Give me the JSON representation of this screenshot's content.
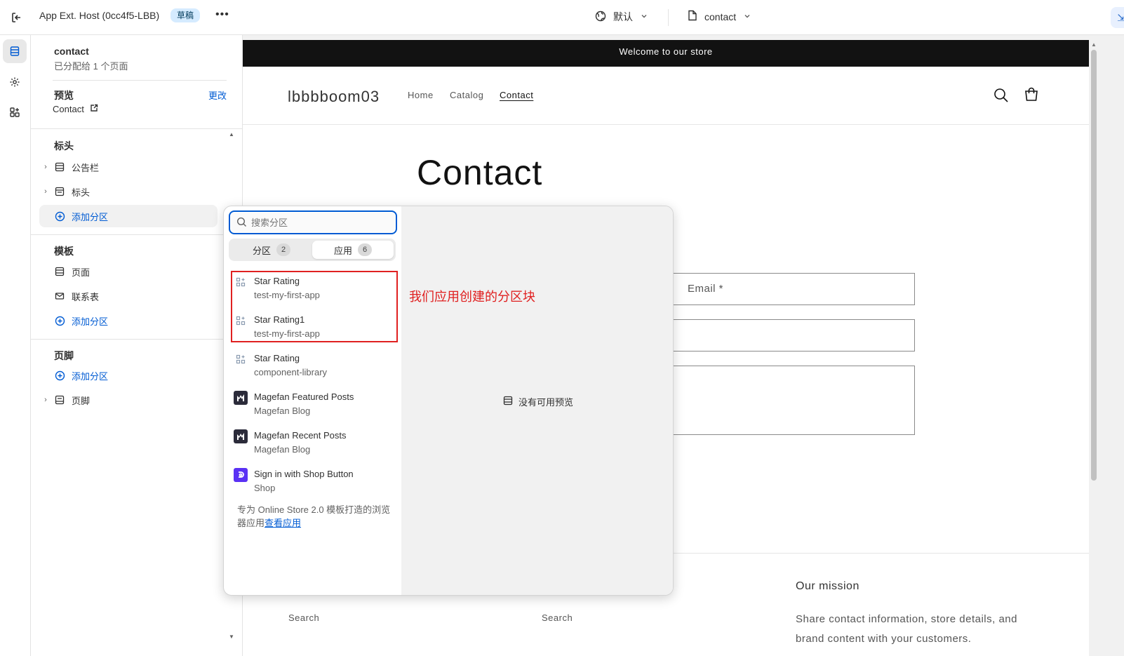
{
  "topbar": {
    "app_title": "App Ext. Host (0cc4f5-LBB)",
    "status_badge": "草稿",
    "more": "•••",
    "theme_label": "默认",
    "page_label": "contact"
  },
  "sidebar": {
    "template_name": "contact",
    "assigned": "已分配给 1 个页面",
    "preview_label": "预览",
    "change_link": "更改",
    "preview_page": "Contact",
    "header_section": {
      "title": "标头",
      "items": [
        "公告栏",
        "标头"
      ],
      "add_label": "添加分区"
    },
    "template_section": {
      "title": "模板",
      "items": [
        "页面",
        "联系表"
      ],
      "add_label": "添加分区"
    },
    "footer_section": {
      "title": "页脚",
      "add_label": "添加分区",
      "items": [
        "页脚"
      ]
    }
  },
  "preview": {
    "announcement": "Welcome to our store",
    "store_name": "lbbbboom03",
    "nav": [
      "Home",
      "Catalog",
      "Contact"
    ],
    "page_heading": "Contact",
    "email_placeholder": "Email *",
    "footer_links": [
      "Search",
      "Search"
    ],
    "footer_heading": "Our mission",
    "footer_text": "Share contact information, store details, and brand content with your customers."
  },
  "popover": {
    "search_placeholder": "搜索分区",
    "tabs": [
      {
        "label": "分区",
        "count": "2"
      },
      {
        "label": "应用",
        "count": "6"
      }
    ],
    "apps": [
      {
        "name": "Star Rating",
        "source": "test-my-first-app",
        "icon": "app-block-icon"
      },
      {
        "name": "Star Rating1",
        "source": "test-my-first-app",
        "icon": "app-block-icon"
      },
      {
        "name": "Star Rating",
        "source": "component-library",
        "icon": "app-block-icon"
      },
      {
        "name": "Magefan Featured Posts",
        "source": "Magefan Blog",
        "icon": "magefan-logo"
      },
      {
        "name": "Magefan Recent Posts",
        "source": "Magefan Blog",
        "icon": "magefan-logo"
      },
      {
        "name": "Sign in with Shop Button",
        "source": "Shop",
        "icon": "shop-logo"
      }
    ],
    "note_text": "专为 Online Store 2.0 模板打造的浏览器应用",
    "note_link": "查看应用",
    "annotation": "我们应用创建的分区块",
    "no_preview": "没有可用预览"
  },
  "colors": {
    "accent": "#005bd3",
    "annotation_red": "#e02020",
    "announcement_bg": "#121212",
    "badge_bg": "#d5ebff"
  }
}
